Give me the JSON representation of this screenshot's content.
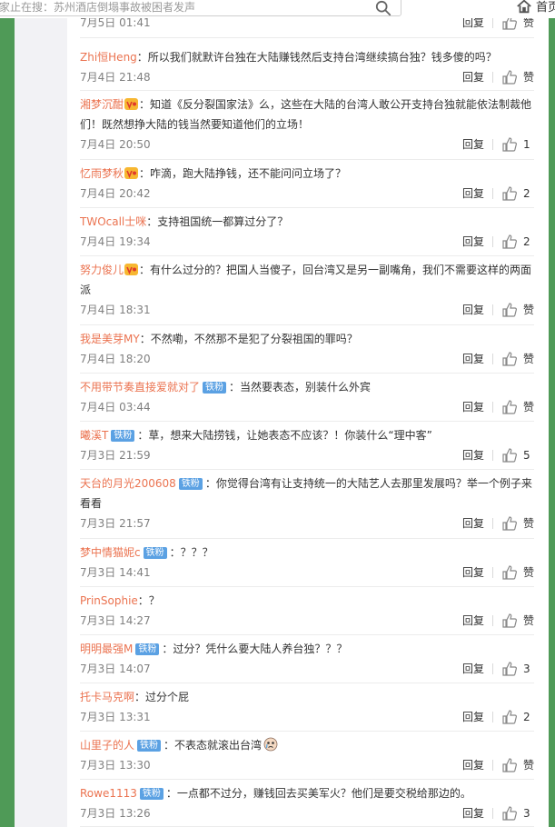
{
  "search": {
    "text": "家止在搜：苏州酒店倒塌事故被困者发声"
  },
  "nav": {
    "home_label": "首页"
  },
  "reply_label": "回复",
  "like_label_default": "赞",
  "partial_top_time": "7月5日 01:41",
  "comments": [
    {
      "user": "Zhi恒Heng",
      "vip": false,
      "fan": false,
      "text": "：所以我们就默许台独在大陆赚钱然后支持台湾继续搞台独？钱多傻的吗？",
      "time": "7月4日 21:48",
      "likes": "赞"
    },
    {
      "user": "湘梦沉酣",
      "vip": true,
      "fan": false,
      "text": "：知道《反分裂国家法》么，这些在大陆的台湾人敢公开支持台独就能依法制裁他们！既然想挣大陆的钱当然要知道他们的立场！",
      "time": "7月4日 20:50",
      "likes": "1"
    },
    {
      "user": "忆雨梦秋",
      "vip": true,
      "fan": false,
      "text": "：咋滴，跑大陆挣钱，还不能问问立场了？",
      "time": "7月4日 20:42",
      "likes": "2"
    },
    {
      "user": "TWOcall士咪",
      "vip": false,
      "fan": false,
      "text": "：支持祖国统一都算过分了？",
      "time": "7月4日 19:34",
      "likes": "2"
    },
    {
      "user": "努力俊儿",
      "vip": true,
      "fan": false,
      "text": "：有什么过分的？把国人当傻子，回台湾又是另一副嘴角，我们不需要这样的两面派",
      "time": "7月4日 18:31",
      "likes": "赞"
    },
    {
      "user": "我是美芽MY",
      "vip": false,
      "fan": false,
      "text": "：不然嘞，不然那不是犯了分裂祖国的罪吗？",
      "time": "7月4日 18:20",
      "likes": "赞"
    },
    {
      "user": "不用带节奏直接爱就对了",
      "vip": false,
      "fan": true,
      "text": "：当然要表态，别装什么外宾",
      "time": "7月4日 03:44",
      "likes": "赞"
    },
    {
      "user": "曦溪T",
      "vip": false,
      "fan": true,
      "text": "：草，想来大陆捞钱，让她表态不应该？！你装什么“理中客”",
      "time": "7月3日 21:59",
      "likes": "5"
    },
    {
      "user": "天台的月光200608",
      "vip": false,
      "fan": true,
      "text": "：你觉得台湾有让支持统一的大陆艺人去那里发展吗？举一个例子来看看",
      "time": "7月3日 21:57",
      "likes": "赞"
    },
    {
      "user": "梦中情猫妮c",
      "vip": false,
      "fan": true,
      "text": "：？？？",
      "time": "7月3日 14:41",
      "likes": "赞"
    },
    {
      "user": "PrinSophie",
      "vip": false,
      "fan": false,
      "text": "：？",
      "time": "7月3日 14:27",
      "likes": "赞"
    },
    {
      "user": "明明最强M",
      "vip": false,
      "fan": true,
      "text": "：过分？凭什么要大陆人养台独？？？",
      "time": "7月3日 14:07",
      "likes": "3"
    },
    {
      "user": "托卡马克啊",
      "vip": false,
      "fan": false,
      "text": "：过分个屁",
      "time": "7月3日 13:31",
      "likes": "2"
    },
    {
      "user": "山里子的人",
      "vip": false,
      "fan": true,
      "text": "：不表态就滚出台湾",
      "emoji": true,
      "time": "7月3日 13:30",
      "likes": "赞"
    },
    {
      "user": "Rowe1113",
      "vip": false,
      "fan": true,
      "text": "：一点都不过分，赚钱回去买美军火？他们是要交税给那边的。",
      "time": "7月3日 13:26",
      "likes": "3"
    }
  ],
  "fan_badge_label": "铁粉",
  "colors": {
    "username": "#eb7350",
    "fan_badge": "#5ba1e3",
    "sidebar_green": "#4f9a57"
  }
}
